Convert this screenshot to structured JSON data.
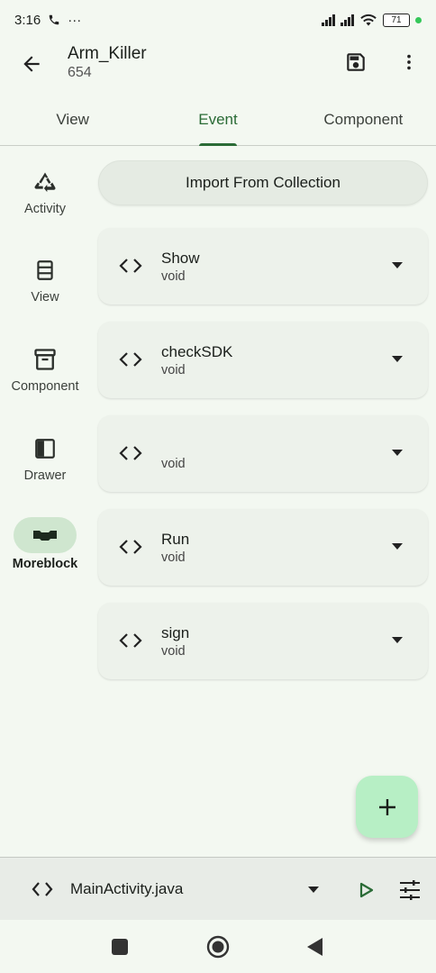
{
  "status_bar": {
    "time": "3:16",
    "call_icon": "phone-icon",
    "dots": "···",
    "battery_level": "71"
  },
  "app_bar": {
    "title": "Arm_Killer",
    "subtitle": "654"
  },
  "tabs": [
    {
      "label": "View",
      "active": false
    },
    {
      "label": "Event",
      "active": true
    },
    {
      "label": "Component",
      "active": false
    }
  ],
  "sidebar": {
    "items": [
      {
        "label": "Activity",
        "icon": "recycle-icon"
      },
      {
        "label": "View",
        "icon": "view-list-icon"
      },
      {
        "label": "Component",
        "icon": "archive-box-icon"
      },
      {
        "label": "Drawer",
        "icon": "drawer-panel-icon"
      },
      {
        "label": "Moreblock",
        "icon": "block-icon",
        "active": true
      }
    ]
  },
  "import_button": {
    "label": "Import From Collection"
  },
  "moreblocks": [
    {
      "name": "Show",
      "type": "void"
    },
    {
      "name": "checkSDK",
      "type": "void"
    },
    {
      "name": "",
      "type": "void"
    },
    {
      "name": "Run",
      "type": "void"
    },
    {
      "name": "sign",
      "type": "void"
    }
  ],
  "fab": {
    "label": "+"
  },
  "bottom_bar": {
    "file": "MainActivity.java"
  },
  "colors": {
    "accent": "#2a6b36",
    "background": "#f3f8f1",
    "fab": "#b7efc5",
    "card": "#edf2eb"
  }
}
